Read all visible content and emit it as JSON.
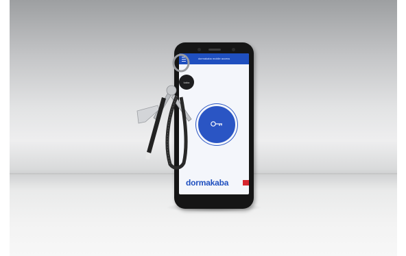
{
  "scene": {
    "description_subject": "smartphone-with-keys",
    "app": {
      "header_text": "dormakaba mobile access",
      "brand_logo_text": "dormakaba",
      "keyring_tag_text": "kaba"
    },
    "colors": {
      "brand_blue": "#2a55c4",
      "brand_red": "#d7262e",
      "phone_body": "#151515"
    }
  }
}
